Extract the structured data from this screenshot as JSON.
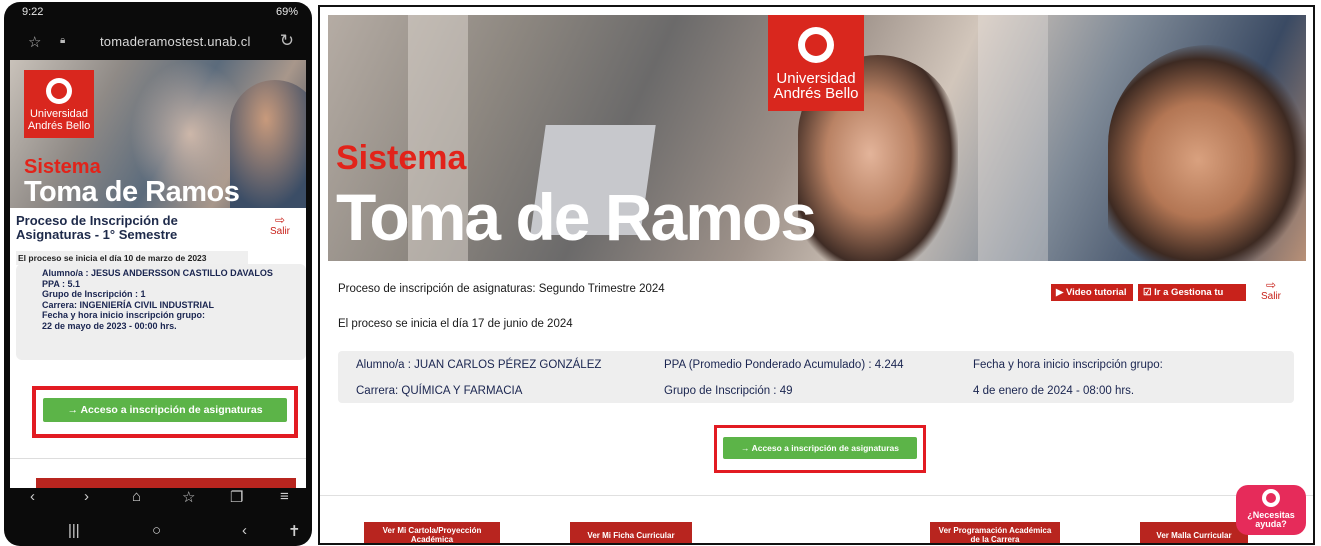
{
  "mobile": {
    "status_time": "9:22",
    "status_right": "69%",
    "url": "tomaderamostest.unab.cl",
    "logo": {
      "line1": "Universidad",
      "line2": "Andrés Bello"
    },
    "hero_sistema": "Sistema",
    "hero_title": "Toma de Ramos",
    "process_title": "Proceso de Inscripción de Asignaturas - 1° Semestre",
    "salir": "Salir",
    "process_date": "El proceso se inicia el día 10 de marzo de 2023",
    "info_lines": [
      "Alumno/a : JESUS ANDERSSON CASTILLO DAVALOS",
      "PPA : 5.1",
      "Grupo de Inscripción : 1",
      "Carrera: INGENIERÍA CIVIL INDUSTRIAL",
      "Fecha y hora inicio inscripción grupo:",
      "22 de mayo de 2023 - 00:00 hrs."
    ],
    "acceso_button": "→  Acceso a inscripción de asignaturas"
  },
  "desktop": {
    "logo": {
      "line1": "Universidad",
      "line2": "Andrés Bello"
    },
    "hero_sistema": "Sistema",
    "hero_title": "Toma de Ramos",
    "process_title": "Proceso de inscripción de asignaturas: Segundo Trimestre 2024",
    "video_button": "▶  Video tutorial",
    "gestiona_button": "☑  Ir a Gestiona tu Caso",
    "salir": "Salir",
    "process_date": "El proceso se inicia el día 17 de junio de 2024",
    "info": {
      "alumno": "Alumno/a : JUAN CARLOS PÉREZ GONZÁLEZ",
      "ppa": "PPA (Promedio Ponderado Acumulado) : 4.244",
      "fecha_label": "Fecha y hora inicio inscripción grupo:",
      "carrera": "Carrera: QUÍMICA Y FARMACIA",
      "grupo": "Grupo de Inscripción : 49",
      "fecha_value": "4 de enero de 2024 - 08:00 hrs."
    },
    "acceso_button": "→  Acceso a inscripción de asignaturas",
    "bottom_buttons": [
      "Ver Mi Cartola/Proyección Académica",
      "Ver Mi Ficha Curricular",
      "Ver Programación Académica de la Carrera",
      "Ver Malla Curricular"
    ],
    "help_label": "¿Necesitas ayuda?"
  },
  "colors": {
    "brand_red": "#d9271e",
    "button_red": "#c8221b",
    "accent_green": "#5cb448",
    "highlight_box": "#e21b22",
    "help_pink": "#e62b5a"
  }
}
